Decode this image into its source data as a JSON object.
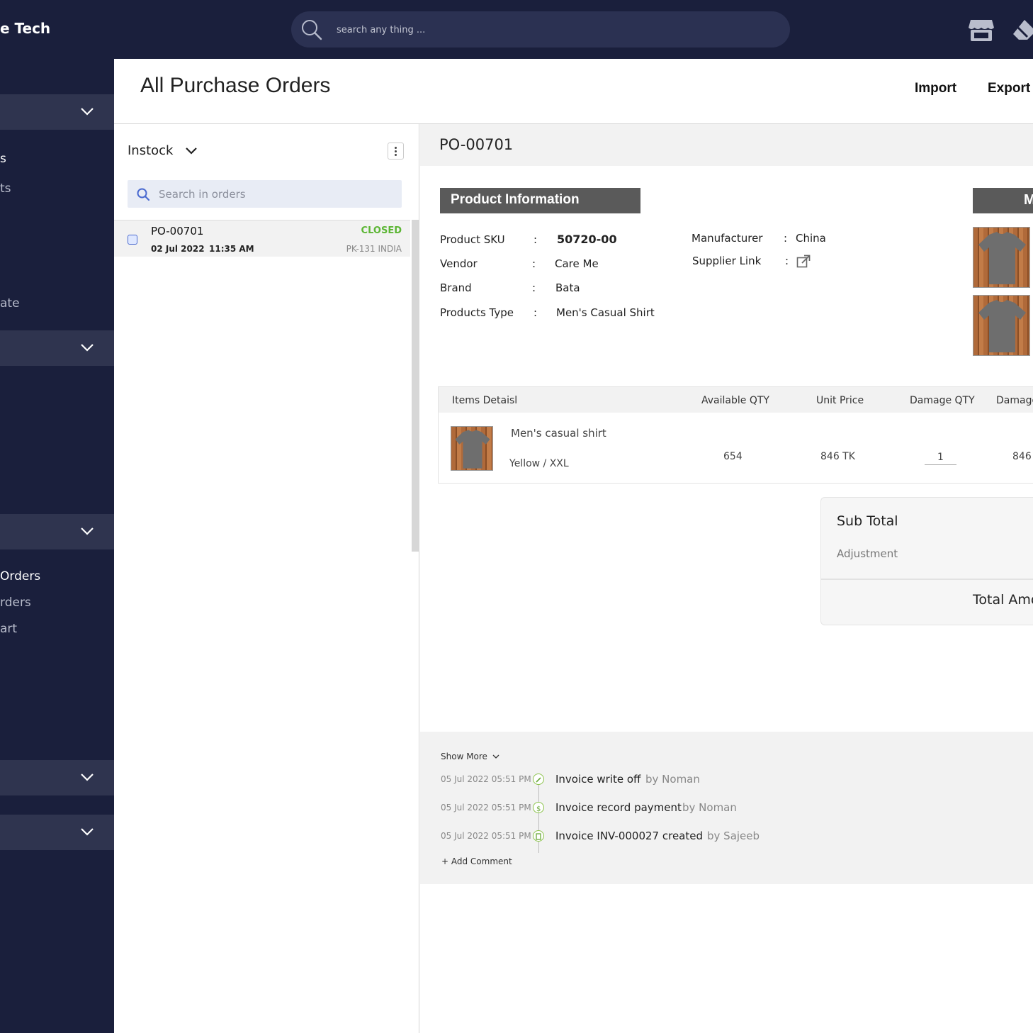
{
  "brand": {
    "name": "e Tech"
  },
  "topbar": {
    "search_placeholder": "search any thing ...",
    "icons": [
      "store-icon",
      "eraser-icon"
    ]
  },
  "sidebar": {
    "items": [
      {
        "label": "s",
        "active": true
      },
      {
        "label": "ts"
      },
      {
        "label": "ate"
      },
      {
        "label": "Orders",
        "active": true
      },
      {
        "label": "rders"
      },
      {
        "label": "art"
      }
    ]
  },
  "header": {
    "title": "All Purchase Orders",
    "import_label": "Import",
    "export_label": "Export"
  },
  "list": {
    "filter_label": "Instock",
    "search_placeholder": "Search in orders",
    "orders": [
      {
        "id": "PO-00701",
        "status": "CLOSED",
        "date": "02 Jul 2022",
        "time": "11:35 AM",
        "location": "PK-131 INDIA"
      }
    ]
  },
  "detail": {
    "po_number": "PO-00701",
    "section_title": "Product Information",
    "media_title": "M",
    "product": {
      "sku_label": "Product SKU",
      "sku": "50720-00",
      "vendor_label": "Vendor",
      "vendor": "Care Me",
      "brand_label": "Brand",
      "brand": "Bata",
      "type_label": "Products Type",
      "type": "Men's Casual Shirt",
      "manufacturer_label": "Manufacturer",
      "manufacturer": "China",
      "supplier_label": "Supplier Link"
    },
    "items": {
      "headers": [
        "Items Detaisl",
        "Available QTY",
        "Unit Price",
        "Damage QTY",
        "Damage"
      ],
      "rows": [
        {
          "name": "Men's casual shirt",
          "variant": "Yellow / XXL",
          "available": "654",
          "unit_price": "846 TK",
          "damage_qty": "1",
          "damage": "846"
        }
      ]
    },
    "totals": {
      "sub_total_label": "Sub Total",
      "adjustment_label": "Adjustment",
      "total_label": "Total Amo"
    }
  },
  "activity": {
    "show_more": "Show More",
    "events": [
      {
        "time": "05 Jul 2022 05:51 PM",
        "text": "Invoice write off",
        "by": "by Noman",
        "icon": "edit-icon"
      },
      {
        "time": "05 Jul 2022 05:51 PM",
        "text": "Invoice record payment",
        "by": "by Noman",
        "icon": "dollar-icon"
      },
      {
        "time": "05 Jul 2022 05:51 PM",
        "text": "Invoice INV-000027 created",
        "by": "by Sajeeb",
        "icon": "invoice-icon"
      }
    ],
    "add_comment": "+ Add Comment"
  },
  "colors": {
    "navy": "#1a1f3c",
    "status_closed": "#5cb634",
    "section_header": "#5a5a5a"
  }
}
